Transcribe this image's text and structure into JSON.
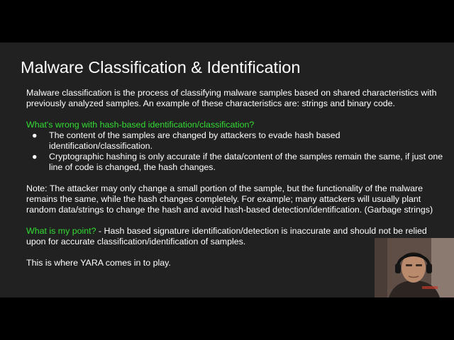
{
  "slide": {
    "title": "Malware Classification & Identification",
    "intro": "Malware classification is the process of classifying malware samples based on shared characteristics with previously analyzed samples. An example of these characteristics are: strings and binary code.",
    "question_heading": "What's wrong with hash-based identification/classification?",
    "bullets": [
      {
        "marker": "●",
        "text": "The content of the samples are changed by attackers to evade hash based identification/classification."
      },
      {
        "marker": "●",
        "text": "Cryptographic hashing is only accurate if the data/content of the samples remain the same, if just one line of code is changed, the hash changes."
      }
    ],
    "note": "Note: The attacker may only change a small portion of the sample, but the functionality of the malware remains the same, while the hash changes completely. For example; many attackers will usually plant random data/strings to change the hash and avoid hash-based detection/identification. (Garbage strings)",
    "point_label": "What is my point?",
    "point_text": " - Hash based signature identification/detection is inaccurate and should not be relied upon for accurate classification/identification of samples.",
    "closing": "This is where YARA comes in to play."
  },
  "colors": {
    "slide_background": "#212121",
    "letterbox": "#000000",
    "highlight_green": "#33dd33",
    "text": "#ffffff"
  }
}
